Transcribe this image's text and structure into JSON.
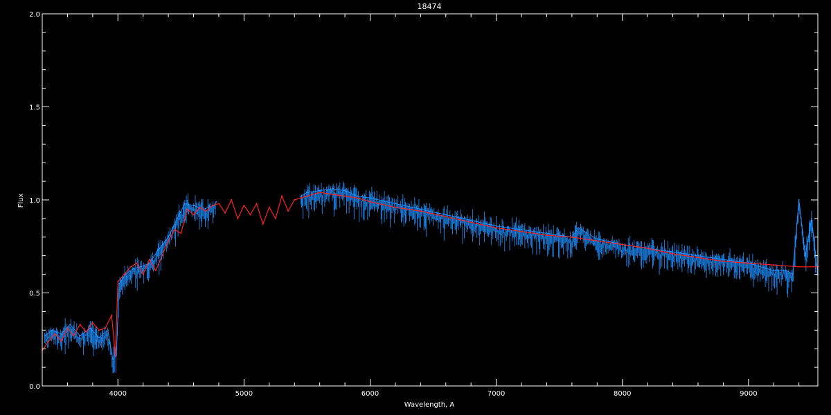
{
  "chart_data": {
    "type": "line",
    "title": "18474",
    "xlabel": "Wavelength, A",
    "ylabel": "Flux",
    "xlim": [
      3400,
      9550
    ],
    "ylim": [
      0.0,
      2.0
    ],
    "xticks": [
      4000,
      5000,
      6000,
      7000,
      8000,
      9000
    ],
    "xtick_labels": [
      "4000",
      "5000",
      "6000",
      "7000",
      "8000",
      "9000"
    ],
    "yticks": [
      0.0,
      0.5,
      1.0,
      1.5,
      2.0
    ],
    "ytick_labels": [
      "0.0",
      "0.5",
      "1.0",
      "1.5",
      "2.0"
    ],
    "grid": false,
    "background": "#000000",
    "colors": {
      "axes": "#ffffff",
      "observed": "#1e90ff",
      "model": "#ff2020",
      "continuum": "#ffffff"
    },
    "series": [
      {
        "role": "observed",
        "color": "#1e90ff",
        "x": [
          3420,
          3480,
          3550,
          3620,
          3700,
          3780,
          3850,
          3920,
          3960,
          3990,
          4010,
          4060,
          4120,
          4180,
          4250,
          4320,
          4400,
          4470,
          4530,
          4600,
          4680,
          4760,
          4780
        ],
        "y": [
          0.27,
          0.3,
          0.28,
          0.33,
          0.27,
          0.31,
          0.26,
          0.3,
          0.14,
          0.2,
          0.55,
          0.6,
          0.63,
          0.64,
          0.66,
          0.73,
          0.8,
          0.9,
          0.98,
          0.97,
          0.95,
          0.97,
          0.99
        ]
      },
      {
        "role": "observed",
        "color": "#1e90ff",
        "x": [
          5450,
          5500,
          5600,
          5700,
          5800,
          5900,
          6000,
          6200,
          6400,
          6600,
          6800,
          7000,
          7200,
          7400,
          7600,
          7650,
          7800,
          8000,
          8200,
          8400,
          8600,
          8800,
          9000,
          9200,
          9300,
          9350,
          9400,
          9450,
          9500,
          9550
        ],
        "y": [
          1.02,
          1.04,
          1.05,
          1.06,
          1.05,
          1.02,
          1.01,
          0.98,
          0.95,
          0.92,
          0.89,
          0.86,
          0.84,
          0.82,
          0.8,
          0.85,
          0.79,
          0.76,
          0.74,
          0.72,
          0.7,
          0.68,
          0.66,
          0.62,
          0.62,
          0.6,
          1.0,
          0.7,
          0.9,
          0.6
        ]
      },
      {
        "role": "model",
        "color": "#ff2020",
        "x": [
          3400,
          3450,
          3500,
          3550,
          3600,
          3650,
          3700,
          3750,
          3800,
          3850,
          3900,
          3950,
          3980,
          4000,
          4050,
          4100,
          4150,
          4200,
          4250,
          4300,
          4350,
          4400,
          4450,
          4500,
          4550,
          4600,
          4650,
          4700,
          4750,
          4800,
          4850,
          4900,
          4950,
          5000,
          5050,
          5100,
          5150,
          5200,
          5250,
          5300,
          5350,
          5400,
          5450,
          5500,
          5600,
          5700,
          5800,
          5900,
          6000,
          6200,
          6400,
          6600,
          6800,
          7000,
          7200,
          7400,
          7600,
          7800,
          8000,
          8200,
          8400,
          8600,
          8800,
          9000,
          9200,
          9400,
          9550
        ],
        "y": [
          0.19,
          0.24,
          0.28,
          0.24,
          0.31,
          0.27,
          0.33,
          0.29,
          0.34,
          0.3,
          0.31,
          0.38,
          0.16,
          0.56,
          0.6,
          0.64,
          0.66,
          0.6,
          0.68,
          0.62,
          0.7,
          0.78,
          0.84,
          0.82,
          0.95,
          0.92,
          0.96,
          0.94,
          0.97,
          0.98,
          0.93,
          1.0,
          0.9,
          0.97,
          0.92,
          0.98,
          0.87,
          0.96,
          0.9,
          1.02,
          0.94,
          1.0,
          1.01,
          1.02,
          1.04,
          1.03,
          1.02,
          1.01,
          0.99,
          0.96,
          0.94,
          0.91,
          0.88,
          0.85,
          0.83,
          0.81,
          0.8,
          0.78,
          0.76,
          0.74,
          0.71,
          0.69,
          0.67,
          0.66,
          0.65,
          0.64,
          0.64
        ]
      }
    ]
  }
}
